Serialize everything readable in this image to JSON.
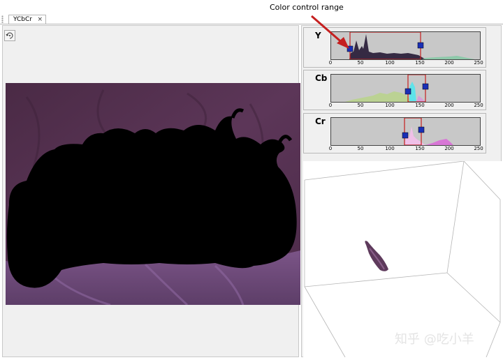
{
  "tabs": [
    {
      "label": "YCbCr",
      "close_glyph": "×"
    }
  ],
  "annotation": {
    "label": "Color control range"
  },
  "tools": {
    "left_icon": "rotate-icon",
    "right_icon": "rotate-3d-icon"
  },
  "histograms": [
    {
      "channel": "Y",
      "range_low": 31,
      "range_high": 151,
      "ticks": [
        "0",
        "50",
        "100",
        "150",
        "200",
        "250"
      ]
    },
    {
      "channel": "Cb",
      "range_low": 131,
      "range_high": 160,
      "ticks": [
        "0",
        "50",
        "100",
        "150",
        "200",
        "250"
      ]
    },
    {
      "channel": "Cr",
      "range_low": 124,
      "range_high": 153,
      "ticks": [
        "0",
        "50",
        "100",
        "150",
        "200",
        "250"
      ]
    }
  ],
  "colors": {
    "accent_red": "#c51f1f",
    "handle_blue": "#1a2fb5",
    "plot_bg": "#c8c8c8"
  },
  "watermark": "知乎 @吃小羊"
}
